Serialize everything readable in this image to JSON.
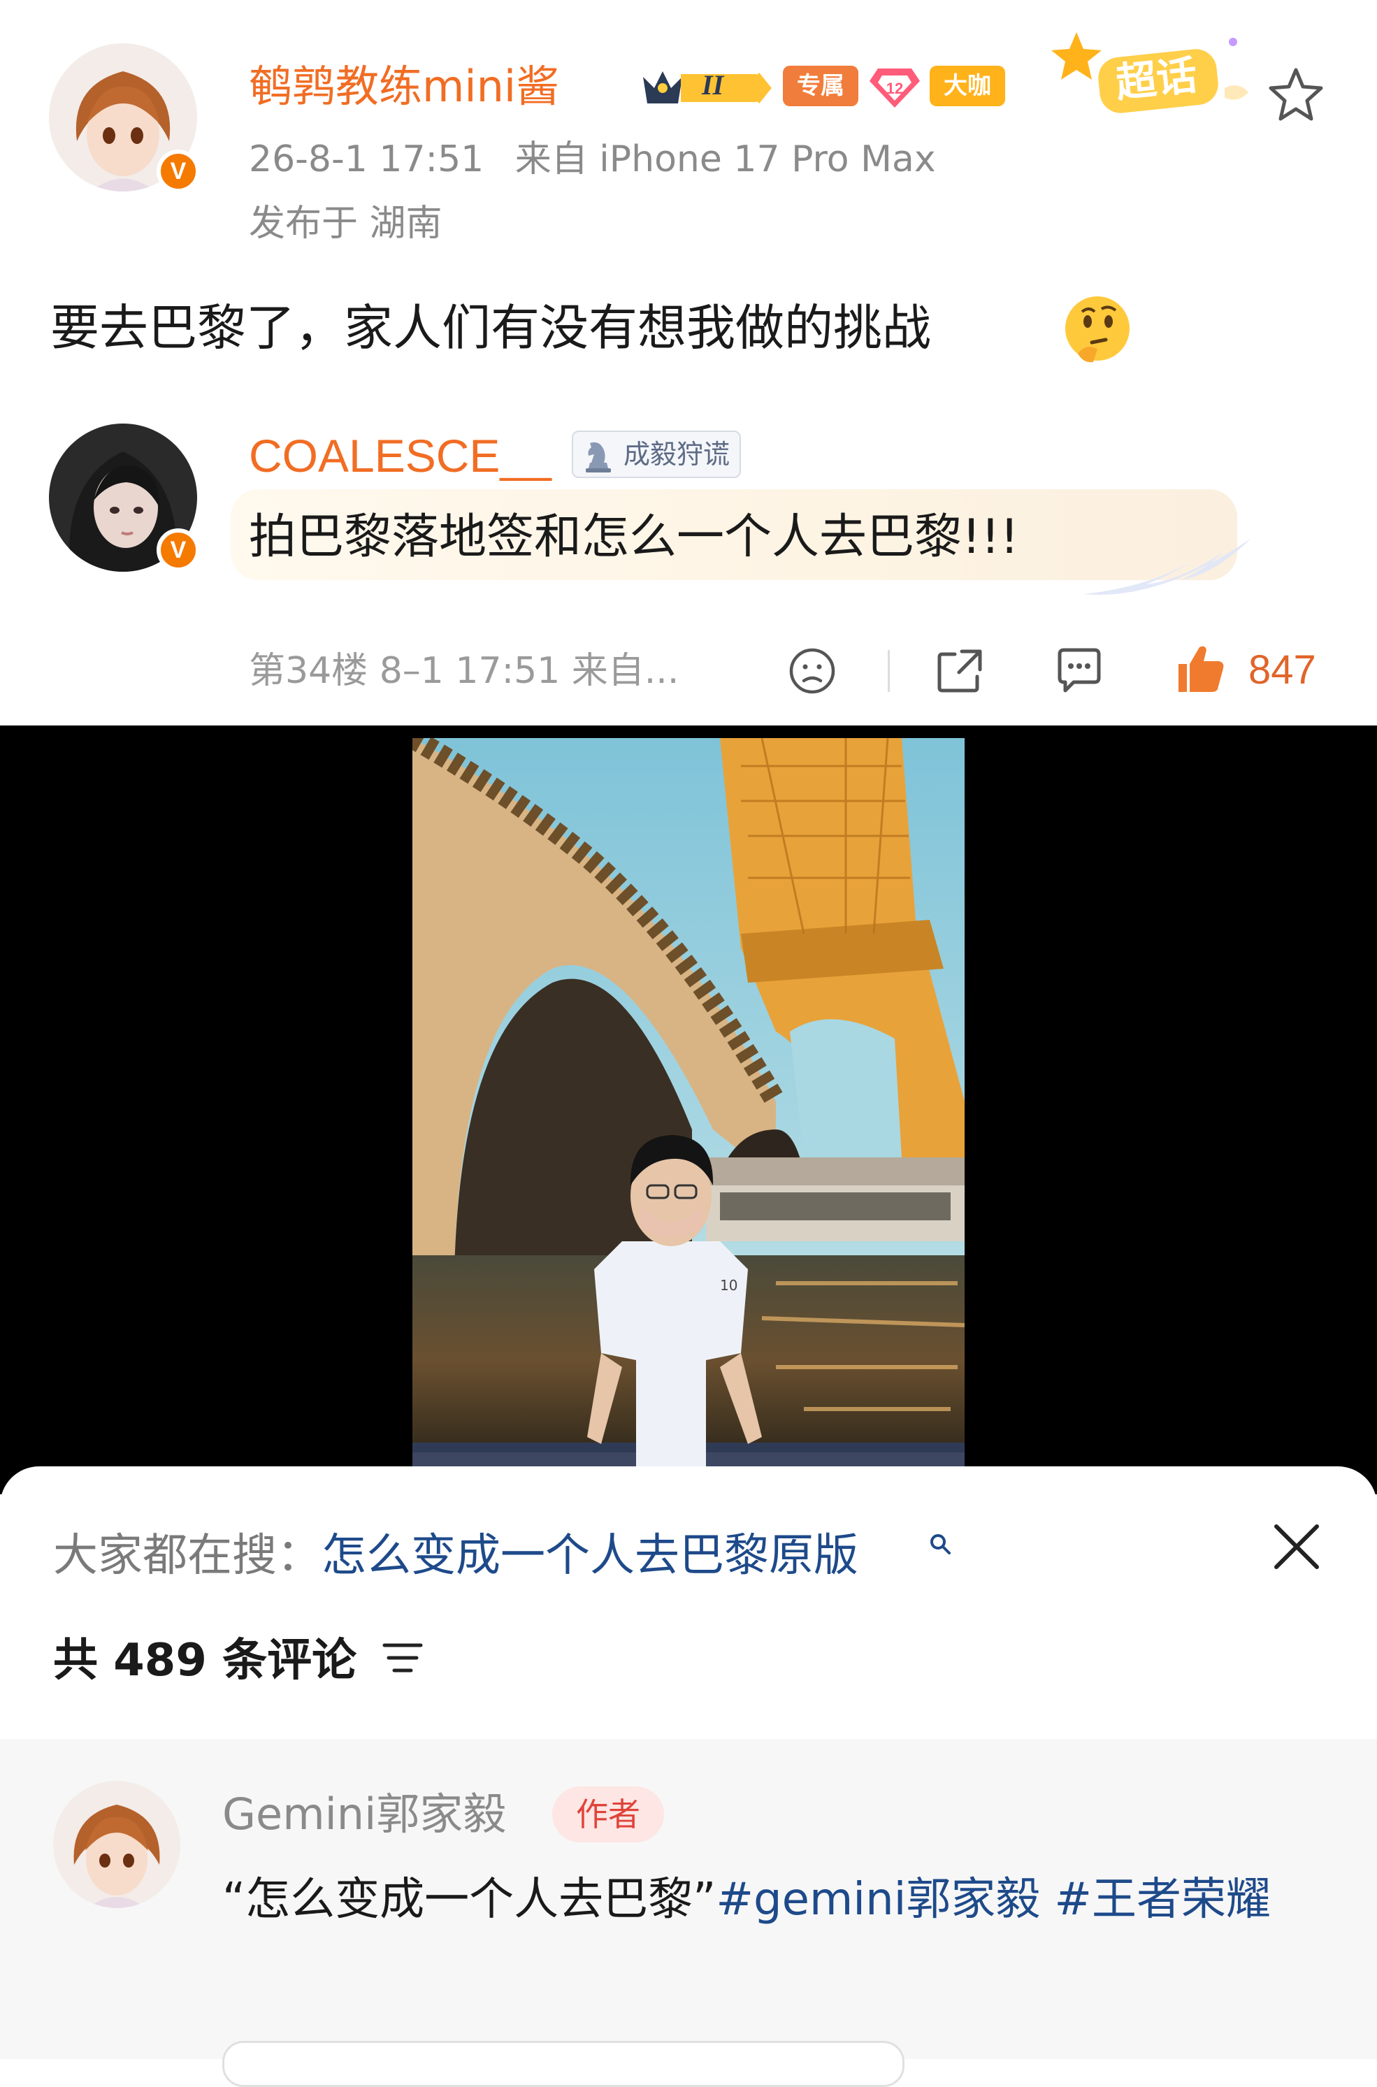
{
  "post": {
    "username": "鹌鹑教练mini酱",
    "level_badge": "II",
    "badge_exclusive": "专属",
    "badge_daka": "大咖",
    "super_topic": "超话",
    "timestamp": "26-8-1 17:51",
    "source": "来自 iPhone 17 Pro Max",
    "location": "发布于 湖南",
    "text": "要去巴黎了，家人们有没有想我做的挑战",
    "emoji": "thinking-face"
  },
  "comment": {
    "username": "COALESCE__",
    "fan_badge": "成毅狩谎",
    "text": "拍巴黎落地签和怎么一个人去巴黎!!!",
    "floor_meta": "第34楼 8–1 17:51 来自...",
    "like_count": "847"
  },
  "video": {
    "description": "photo-video frame: person in white t-shirt and mask standing by the Seine with bridge and Eiffel Tower"
  },
  "sheet": {
    "search_label": "大家都在搜：",
    "search_query": "怎么变成一个人去巴黎原版",
    "comment_count": "共 489 条评论"
  },
  "reply": {
    "username": "Gemini郭家毅",
    "author_tag": "作者",
    "text_prefix": "“怎么变成一个人去巴黎”",
    "tag1": "#gemini郭家毅",
    "tag2": "#王者荣耀"
  },
  "colors": {
    "username_orange": "#f16d24",
    "link_blue": "#1e4a8a",
    "like_orange": "#e0652a",
    "verified_orange": "#f57a00"
  }
}
